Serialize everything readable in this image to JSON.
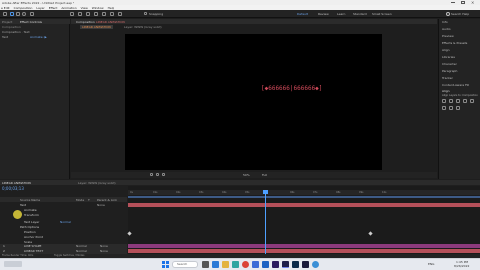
{
  "app": {
    "title": "Adobe After Effects 2022 - Untitled Project.aep *",
    "menu": [
      "Composition",
      "Layer",
      "Effect",
      "Animation",
      "View",
      "Window",
      "Help"
    ],
    "menu_prefix": "e Edit"
  },
  "toolbar": {
    "snapping_label": "Snapping",
    "workspaces": [
      "Default",
      "Review",
      "Learn",
      "Standard",
      "Small Screen"
    ],
    "search_label": "Search Help"
  },
  "left_panel": {
    "tab_project": "Project",
    "tab_effects": "Effect Controls",
    "effects_target": "Composition",
    "rows": [
      "Composition · Text",
      "Text",
      "Animate: ▶"
    ]
  },
  "comp_panel": {
    "tab_label": "Composition",
    "tab_name": "LINEAR ANIMATION",
    "breadcrumb_1": "LINEAR ANIMATION",
    "breadcrumb_2": "Layer: WWW (Gray solid)",
    "canvas_text": "[◆666666|666666◆]",
    "zoom": "50%",
    "quality": "Full",
    "timecode": "0;00;03;13"
  },
  "right_panel": {
    "items": [
      "Info",
      "Audio",
      "Preview",
      "Effects & Presets",
      "Align",
      "Libraries",
      "Character",
      "Paragraph",
      "Tracker",
      "Content-Aware Fill"
    ],
    "align_label": "Align",
    "align_to": "Align Layers to: Composition"
  },
  "timeline": {
    "tab_label": "LINEAR ANIMATION",
    "tab_close": "Layer: WWW (Gray solid)",
    "timecode": "0;00;03;13",
    "columns": [
      "Source Name",
      "Mode",
      "T",
      "Parent & Link"
    ],
    "layers": [
      {
        "label": "Text",
        "mode": "None"
      },
      {
        "label": "Animate",
        "mode": ""
      },
      {
        "label": "Transform",
        "mode": ""
      },
      {
        "label": "Text Layer",
        "mode": "Normal"
      },
      {
        "label": "Path Options",
        "mode": ""
      },
      {
        "label": "Position",
        "mode": ""
      },
      {
        "label": "Anchor Point",
        "mode": ""
      },
      {
        "label": "Scale",
        "mode": ""
      }
    ],
    "bottom_layers": [
      {
        "num": "1",
        "name": "LINE SHAPE",
        "mode": "Normal",
        "parent": "None"
      },
      {
        "num": "2",
        "name": "LINEAR TEXT",
        "mode": "Normal",
        "parent": "None"
      }
    ],
    "ruler_ticks": [
      "0s",
      "01s",
      "02s",
      "03s",
      "04s",
      "05s",
      "06s",
      "07s",
      "08s",
      "09s",
      "10s"
    ],
    "footer": "Toggle Switches / Modes",
    "footer_render": "Frame Render Time: 0ms"
  },
  "taskbar": {
    "search_placeholder": "Search",
    "time": "1:45 PM",
    "date": "8/26/2022",
    "lang": "ENG"
  },
  "colors": {
    "accent_blue": "#2d8ceb",
    "playhead": "#4ea0ff",
    "layer_red": "#b5505a",
    "layer_magenta": "#8c3a7c",
    "cursor_yellow": "#d7c73a",
    "taskbar": "#e6e9ef"
  }
}
